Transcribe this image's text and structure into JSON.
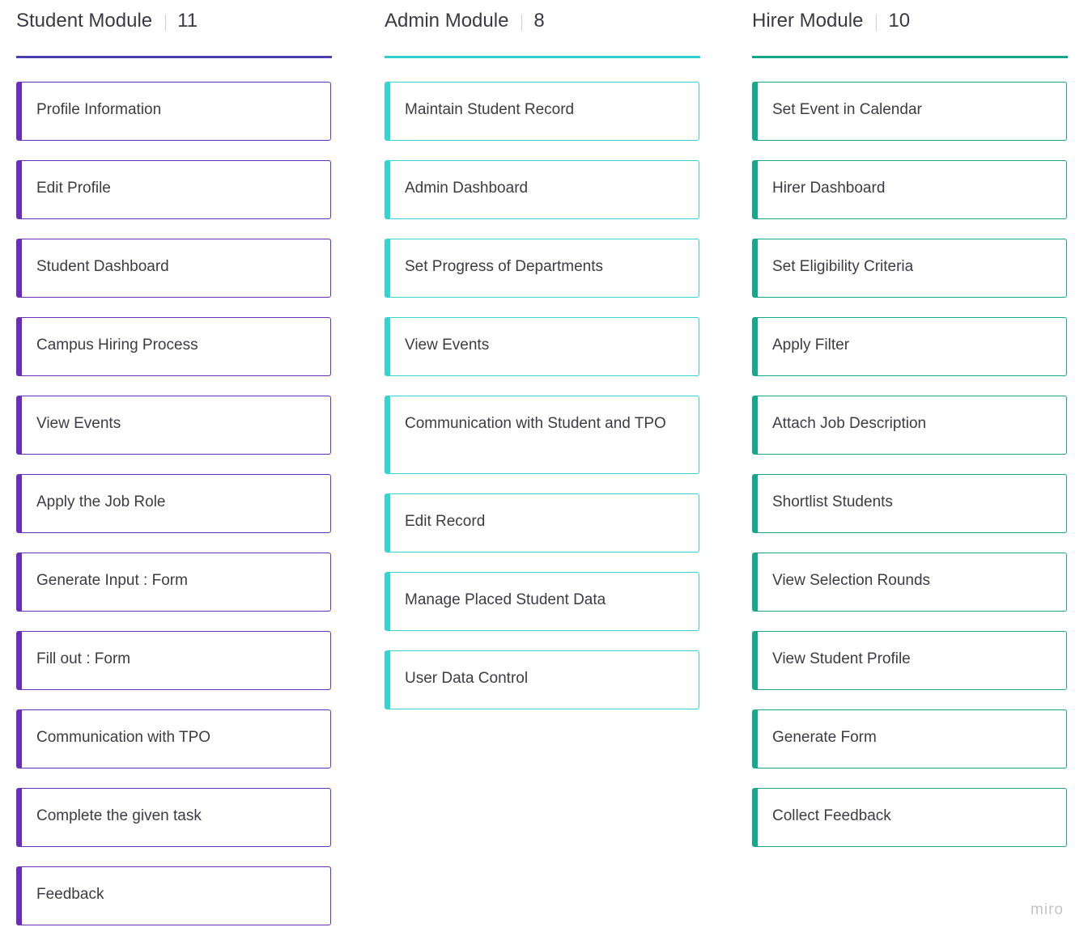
{
  "columns": [
    {
      "title": "Student Module",
      "count": "11",
      "accent": "#6a2fb8",
      "cards": [
        "Profile Information",
        "Edit Profile",
        "Student Dashboard",
        "Campus Hiring Process",
        "View Events",
        "Apply the Job Role",
        "Generate Input : Form",
        "Fill out : Form",
        "Communication with TPO",
        "Complete the given task",
        "Feedback"
      ]
    },
    {
      "title": "Admin Module",
      "count": "8",
      "accent": "#32d4d4",
      "cards": [
        "Maintain Student Record",
        "Admin Dashboard",
        "Set Progress of Departments",
        "View Events",
        "Communication with Student and TPO",
        "Edit Record",
        "Manage Placed Student Data",
        "User Data Control"
      ]
    },
    {
      "title": "Hirer Module",
      "count": "10",
      "accent": "#14a88c",
      "cards": [
        "Set Event in Calendar",
        "Hirer Dashboard",
        "Set Eligibility Criteria",
        "Apply Filter",
        "Attach Job Description",
        "Shortlist Students",
        "View Selection Rounds",
        "View Student Profile",
        "Generate Form",
        "Collect Feedback"
      ]
    }
  ],
  "watermark": "miro"
}
